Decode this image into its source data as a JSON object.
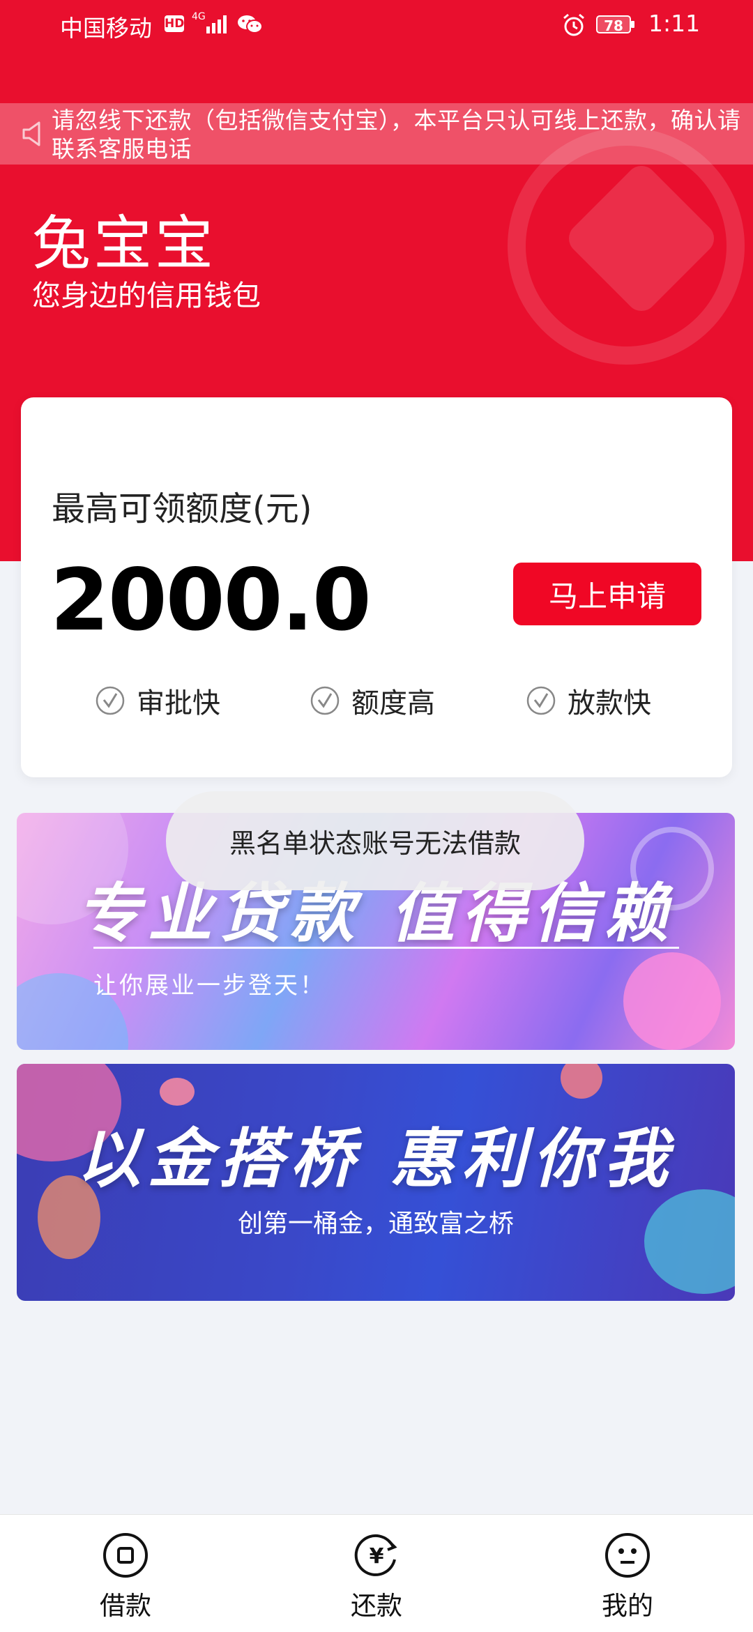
{
  "status_bar": {
    "carrier": "中国移动",
    "hd": "HD",
    "network": "4G",
    "battery": "78",
    "time": "1:11"
  },
  "notice": {
    "text": "请忽线下还款（包括微信支付宝），本平台只认可线上还款，确认请联系客服电话"
  },
  "header": {
    "title": "兔宝宝",
    "subtitle": "您身边的信用钱包"
  },
  "card": {
    "label": "最高可领额度(元)",
    "amount": "2000.0",
    "apply_label": "马上申请",
    "features": [
      "审批快",
      "额度高",
      "放款快"
    ]
  },
  "banners": [
    {
      "headline": "专业贷款 值得信赖",
      "tagline": "让你展业一步登天！"
    },
    {
      "headline": "以金搭桥 惠利你我",
      "tagline": "创第一桶金，通致富之桥"
    }
  ],
  "toast": {
    "text": "黑名单状态账号无法借款"
  },
  "bottom_nav": [
    {
      "label": "借款"
    },
    {
      "label": "还款"
    },
    {
      "label": "我的"
    }
  ],
  "colors": {
    "brand_red": "#e90f2e",
    "button_red": "#f00725",
    "page_bg": "#f1f3f8"
  }
}
